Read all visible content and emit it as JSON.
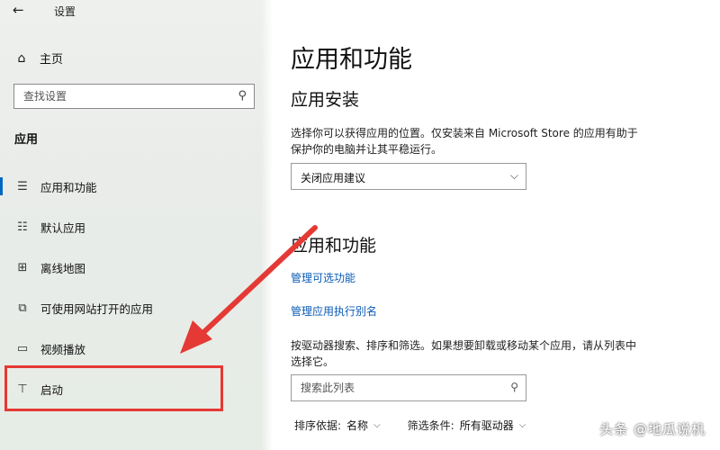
{
  "window": {
    "title": "设置",
    "back_glyph": "←"
  },
  "sidebar": {
    "home_label": "主页",
    "search_placeholder": "查找设置",
    "section_label": "应用",
    "items": [
      {
        "label": "应用和功能",
        "icon": "apps-features-icon",
        "active": true
      },
      {
        "label": "默认应用",
        "icon": "default-apps-icon"
      },
      {
        "label": "离线地图",
        "icon": "offline-maps-icon"
      },
      {
        "label": "可使用网站打开的应用",
        "icon": "apps-for-websites-icon"
      },
      {
        "label": "视频播放",
        "icon": "video-playback-icon"
      },
      {
        "label": "启动",
        "icon": "startup-icon"
      }
    ]
  },
  "main": {
    "title": "应用和功能",
    "install_section": {
      "heading": "应用安装",
      "desc_line1": "选择你可以获得应用的位置。仅安装来自 Microsoft Store 的应用有助于",
      "desc_line2": "保护你的电脑并让其平稳运行。",
      "dropdown_value": "关闭应用建议"
    },
    "apps_section": {
      "heading": "应用和功能",
      "link_optional": "管理可选功能",
      "link_alias": "管理应用执行别名",
      "desc_line1": "按驱动器搜索、排序和筛选。如果想要卸载或移动某个应用，请从列表中",
      "desc_line2": "选择它。",
      "search_placeholder": "搜索此列表",
      "sort_label": "排序依据:",
      "sort_value": "名称",
      "filter_label": "筛选条件:",
      "filter_value": "所有驱动器"
    }
  },
  "watermark": "头条 @地瓜说机",
  "annotation": {
    "color": "#e53935"
  }
}
